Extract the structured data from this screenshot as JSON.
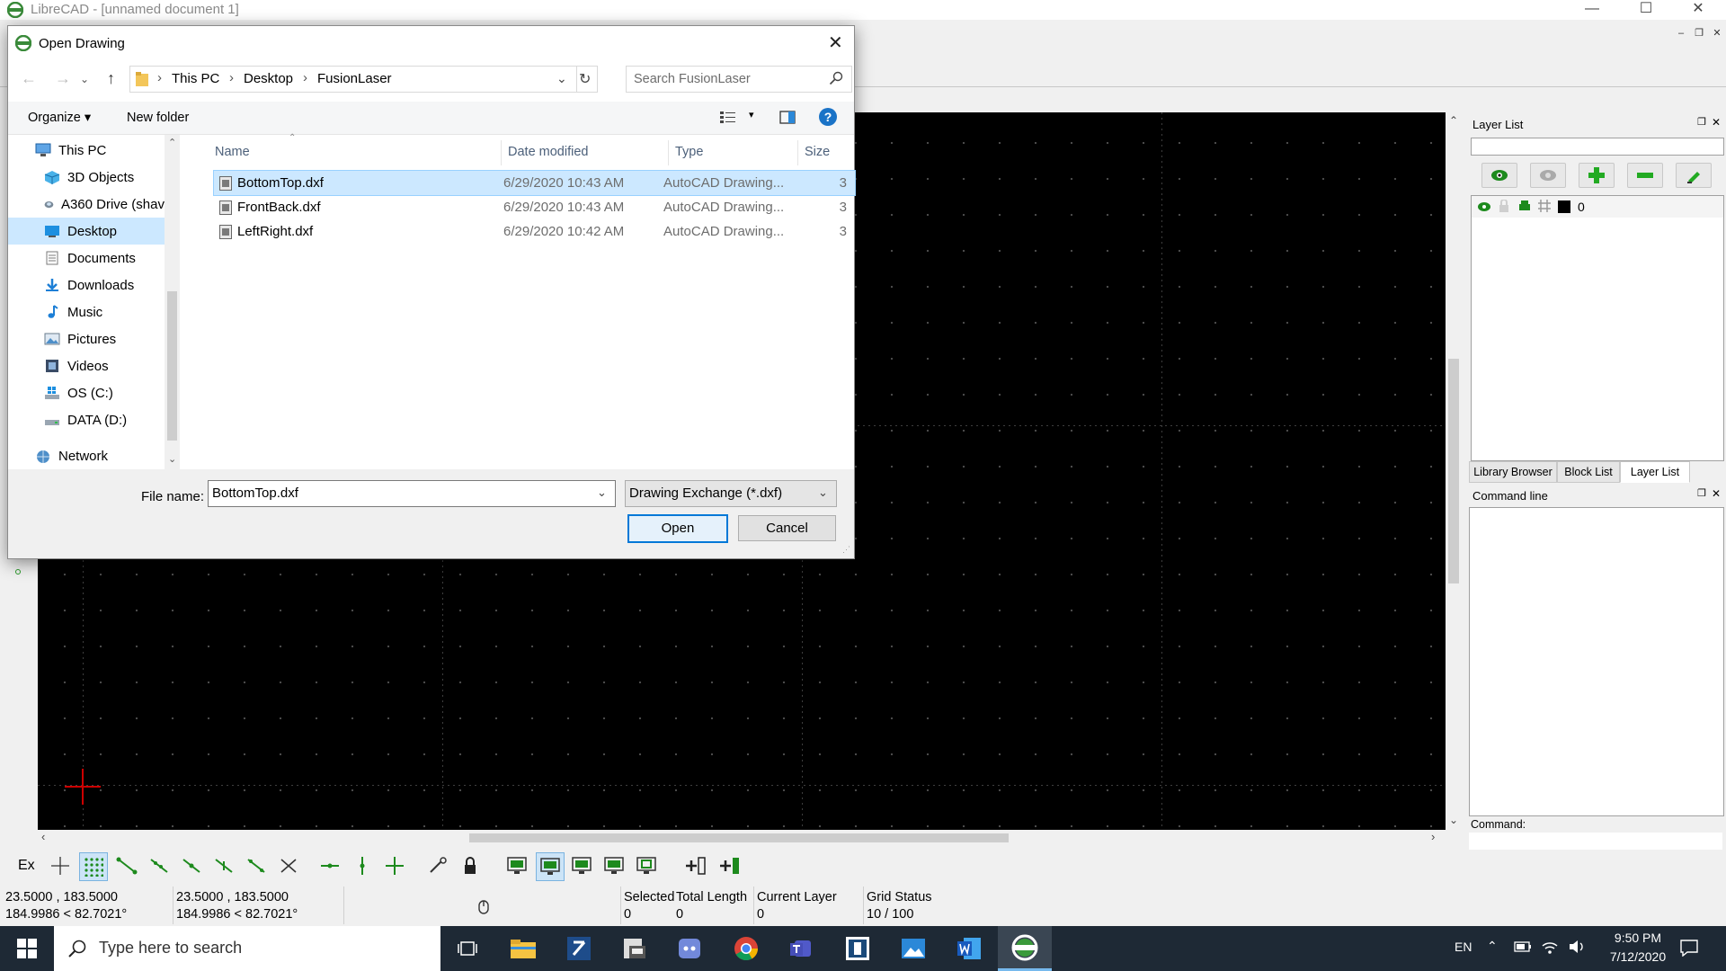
{
  "window": {
    "title": "LibreCAD - [unnamed document 1]"
  },
  "dialog": {
    "title": "Open Drawing",
    "breadcrumb": [
      "This PC",
      "Desktop",
      "FusionLaser"
    ],
    "search_placeholder": "Search FusionLaser",
    "organize_label": "Organize",
    "new_folder_label": "New folder",
    "nav_items": [
      {
        "label": "This PC",
        "icon": "pc-icon"
      },
      {
        "label": "3D Objects",
        "icon": "cube-icon"
      },
      {
        "label": "A360 Drive (shav",
        "icon": "cloud-drive-icon"
      },
      {
        "label": "Desktop",
        "icon": "desktop-icon"
      },
      {
        "label": "Documents",
        "icon": "documents-icon"
      },
      {
        "label": "Downloads",
        "icon": "download-icon"
      },
      {
        "label": "Music",
        "icon": "music-icon"
      },
      {
        "label": "Pictures",
        "icon": "pictures-icon"
      },
      {
        "label": "Videos",
        "icon": "videos-icon"
      },
      {
        "label": "OS (C:)",
        "icon": "drive-icon"
      },
      {
        "label": "DATA (D:)",
        "icon": "drive-icon"
      },
      {
        "label": "Network",
        "icon": "network-icon"
      }
    ],
    "columns": {
      "name": "Name",
      "date": "Date modified",
      "type": "Type",
      "size": "Size"
    },
    "files": [
      {
        "name": "BottomTop.dxf",
        "date": "6/29/2020 10:43 AM",
        "type": "AutoCAD Drawing...",
        "size": "3"
      },
      {
        "name": "FrontBack.dxf",
        "date": "6/29/2020 10:43 AM",
        "type": "AutoCAD Drawing...",
        "size": "3"
      },
      {
        "name": "LeftRight.dxf",
        "date": "6/29/2020 10:42 AM",
        "type": "AutoCAD Drawing...",
        "size": "3"
      }
    ],
    "filename_label": "File name:",
    "filename_value": "BottomTop.dxf",
    "filter_value": "Drawing Exchange (*.dxf)",
    "open_label": "Open",
    "cancel_label": "Cancel"
  },
  "dock": {
    "layer_list_title": "Layer List",
    "layer_name": "0",
    "tabs": [
      "Library Browser",
      "Block List",
      "Layer List"
    ],
    "command_line_title": "Command line",
    "command_label": "Command:"
  },
  "bottom_toolbar": {
    "ex_label": "Ex"
  },
  "status": {
    "abs_coord": "23.5000 , 183.5000",
    "abs_polar": "184.9986 < 82.7021°",
    "rel_coord": "23.5000 , 183.5000",
    "rel_polar": "184.9986 < 82.7021°",
    "selected_label": "Selected",
    "selected_value": "0",
    "total_length_label": "Total Length",
    "total_length_value": "0",
    "current_layer_label": "Current Layer",
    "current_layer_value": "0",
    "grid_status_label": "Grid Status",
    "grid_status_value": "10 / 100"
  },
  "taskbar": {
    "search_placeholder": "Type here to search",
    "language": "EN",
    "time": "9:50 PM",
    "date": "7/12/2020"
  },
  "colors": {
    "accent": "#0078d7",
    "selection": "#cce8ff",
    "canvas": "#000000",
    "taskbar": "#1e2935"
  }
}
